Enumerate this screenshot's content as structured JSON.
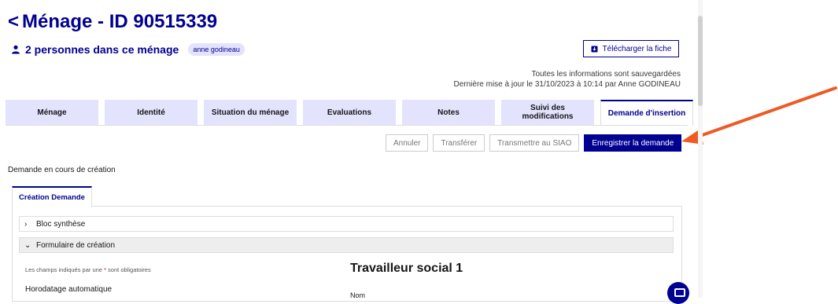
{
  "header": {
    "back_chevron": "<",
    "title": "Ménage - ID 90515339",
    "persons": "2 personnes dans ce ménage",
    "person_badge": "anne godineau",
    "download_button": "Télécharger la fiche",
    "saved_line1": "Toutes les informations sont sauvegardées",
    "saved_line2": "Dernière mise à jour le 31/10/2023 à 10:14 par Anne GODINEAU"
  },
  "tabs": [
    {
      "label": "Ménage"
    },
    {
      "label": "Identité"
    },
    {
      "label": "Situation du ménage"
    },
    {
      "label": "Evaluations"
    },
    {
      "label": "Notes"
    },
    {
      "label": "Suivi des modifications"
    },
    {
      "label": "Demande d'insertion",
      "active": true
    }
  ],
  "actions": {
    "cancel": "Annuler",
    "transfer": "Transférer",
    "transmit": "Transmettre au SIAO",
    "save": "Enregistrer la demande"
  },
  "status_text": "Demande en cours de création",
  "subtab": "Création Demande",
  "accordions": [
    {
      "label": "Bloc synthèse",
      "icon": "chevron-right-icon"
    },
    {
      "label": "Formulaire de création",
      "icon": "chevron-down-icon"
    }
  ],
  "form": {
    "required_prefix": "Les champs indiqués par une",
    "required_star": "*",
    "required_suffix": "sont obligatoires",
    "horodatage_label": "Horodatage automatique",
    "section_title": "Travailleur social 1",
    "nom_label": "Nom"
  },
  "colors": {
    "primary": "#000091",
    "tab_bg": "#e3e3fd",
    "arrow": "#ef5a24",
    "required": "#ce0500"
  }
}
